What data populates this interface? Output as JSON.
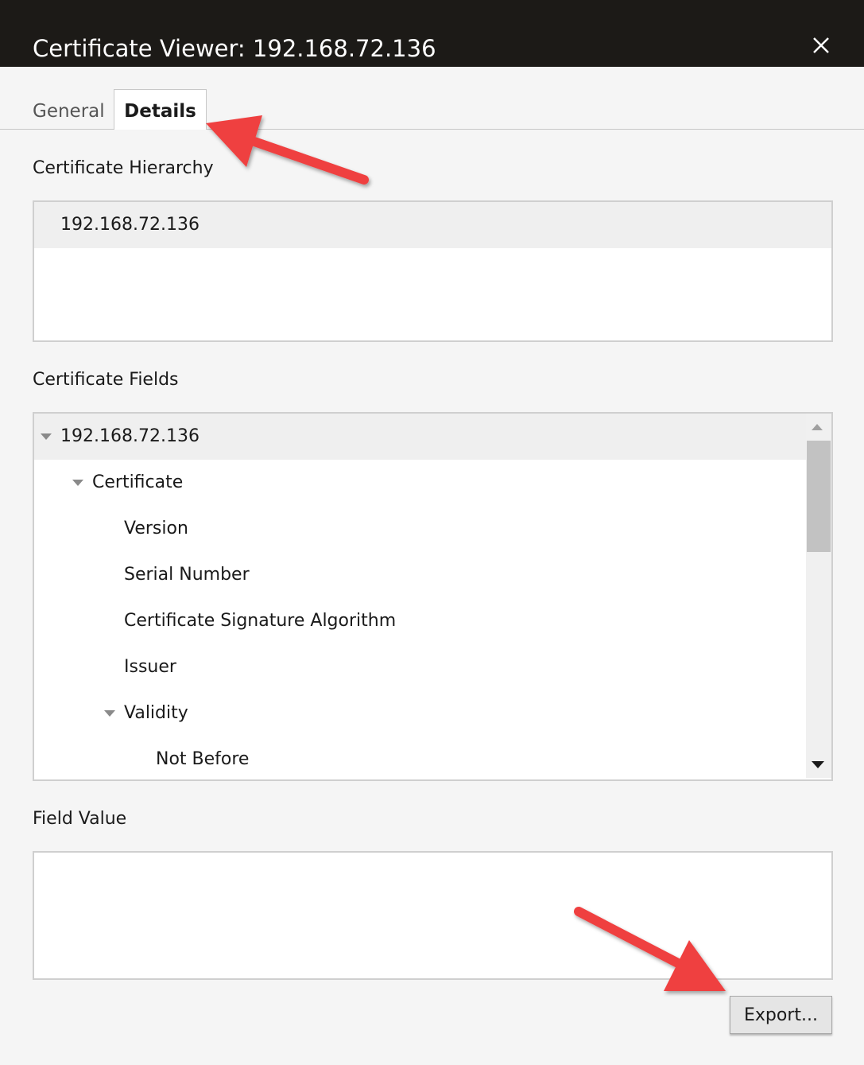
{
  "window": {
    "title": "Certificate Viewer: 192.168.72.136",
    "close_icon": "close-icon"
  },
  "tabs": [
    {
      "label": "General",
      "active": false
    },
    {
      "label": "Details",
      "active": true
    }
  ],
  "hierarchy": {
    "label": "Certificate Hierarchy",
    "items": [
      "192.168.72.136"
    ]
  },
  "fields": {
    "label": "Certificate Fields",
    "rows": [
      {
        "text": "192.168.72.136",
        "expanded": true,
        "selected": true
      },
      {
        "text": "Certificate",
        "expanded": true
      },
      {
        "text": "Version"
      },
      {
        "text": "Serial Number"
      },
      {
        "text": "Certificate Signature Algorithm"
      },
      {
        "text": "Issuer"
      },
      {
        "text": "Validity",
        "expanded": true
      },
      {
        "text": "Not Before"
      }
    ]
  },
  "field_value": {
    "label": "Field Value",
    "value": ""
  },
  "actions": {
    "export_label": "Export..."
  },
  "colors": {
    "titlebar": "#1c1a17",
    "annotation_arrow": "#ef4040",
    "selected_row": "#efefef"
  }
}
